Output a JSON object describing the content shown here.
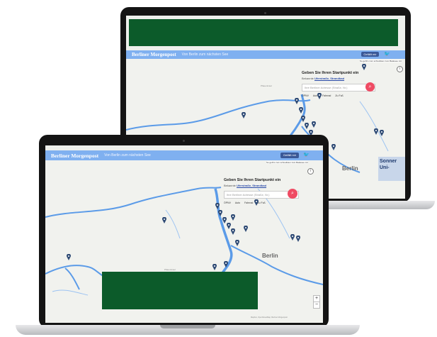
{
  "app": {
    "brand": "Berliner Morgenpost",
    "tagline": "Von Berlin zum nächsten See",
    "share_label": "Gefällt mir",
    "twitter_icon": "twitter-icon"
  },
  "panel": {
    "title": "Geben Sie Ihren Startpunkt ein",
    "subtitle_prefix": "Bekannte",
    "subtitle_link": "Uferstraße, Strandbad",
    "placeholder": "Ihre Berliner Adresse (Straße, Nr.)",
    "modes": [
      "ÖPNV",
      "Auto",
      "Fahrrad",
      "Zu Fuß"
    ],
    "hint": "So geht's zum schnellsten zum Badesee mit",
    "info": "i"
  },
  "map": {
    "city_label": "Berlin",
    "promo": "Sonner Uni-",
    "label_back": "Pfaueninsel",
    "label_front": "Pfaueninsel",
    "zoom_in": "+",
    "zoom_out": "−",
    "attribution": "Mapbox, OpenStreetMap, Berliner Morgenpost"
  },
  "colors": {
    "green": "#0c5b2a",
    "header": "#7fb0f0",
    "pin": "#2f4b75",
    "water": "#5b9be8",
    "search": "#ef4b63"
  }
}
